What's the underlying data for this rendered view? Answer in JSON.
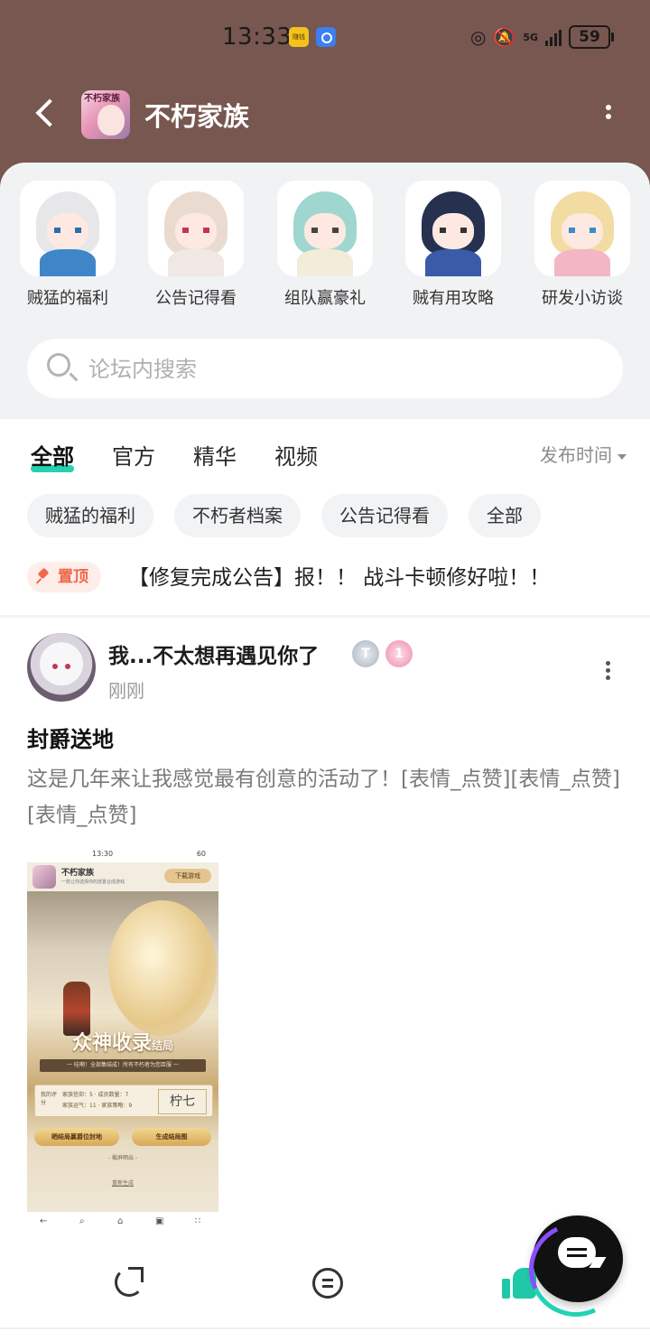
{
  "status_bar": {
    "time": "13:33",
    "app_badge_1": "赚钱",
    "network": "5G",
    "battery": "59"
  },
  "header": {
    "title": "不朽家族",
    "logo_text": "不朽家族"
  },
  "shortcuts": [
    {
      "label": "贼猛的福利",
      "hair": "#e7e7ea",
      "body": "#3f86c8"
    },
    {
      "label": "公告记得看",
      "hair": "#eadbd0",
      "body": "#efe8e4"
    },
    {
      "label": "组队赢豪礼",
      "hair": "#9fd6cf",
      "body": "#f3ecd9"
    },
    {
      "label": "贼有用攻略",
      "hair": "#26304f",
      "body": "#3a5ca8"
    },
    {
      "label": "研发小访谈",
      "hair": "#f3dca2",
      "body": "#f3b6c4"
    }
  ],
  "search": {
    "placeholder": "论坛内搜索"
  },
  "tabs": [
    "全部",
    "官方",
    "精华",
    "视频"
  ],
  "sort_label": "发布时间",
  "chips": [
    "贼猛的福利",
    "不朽者档案",
    "公告记得看",
    "全部"
  ],
  "pinned": {
    "badge": "置顶",
    "title": "【修复完成公告】报！！ 战斗卡顿修好啦！！"
  },
  "post": {
    "username": "我...不太想再遇见你了",
    "badge_t": "T",
    "badge_pink": "1",
    "time": "刚刚",
    "title": "封爵送地",
    "body": "这是几年来让我感觉最有创意的活动了！[表情_点赞][表情_点赞][表情_点赞]",
    "image": {
      "time": "13:30",
      "battery": "60",
      "app_name": "不朽家族",
      "app_sub": "一款让你选择你的放置合成游戏",
      "download": "下载游戏",
      "big_title": "众神收录",
      "big_title_suffix": "结局",
      "ribbon": "一 哇啊！全部集结成！所有不朽者为您臣服 一",
      "score_label": "我的评分",
      "stats": "家族信仰：5 · 成员数量：7\n家族运气：11 · 家族策略：9",
      "signature": "柠七",
      "btn_left": "晒结局赢爵位封地",
      "btn_right": "生成结局图",
      "save_hint": "- 截屏晒出 -",
      "regen": "重新生成"
    }
  },
  "colors": {
    "header_bg": "#77574f",
    "accent": "#24d1b0",
    "pin": "#f1684a"
  }
}
